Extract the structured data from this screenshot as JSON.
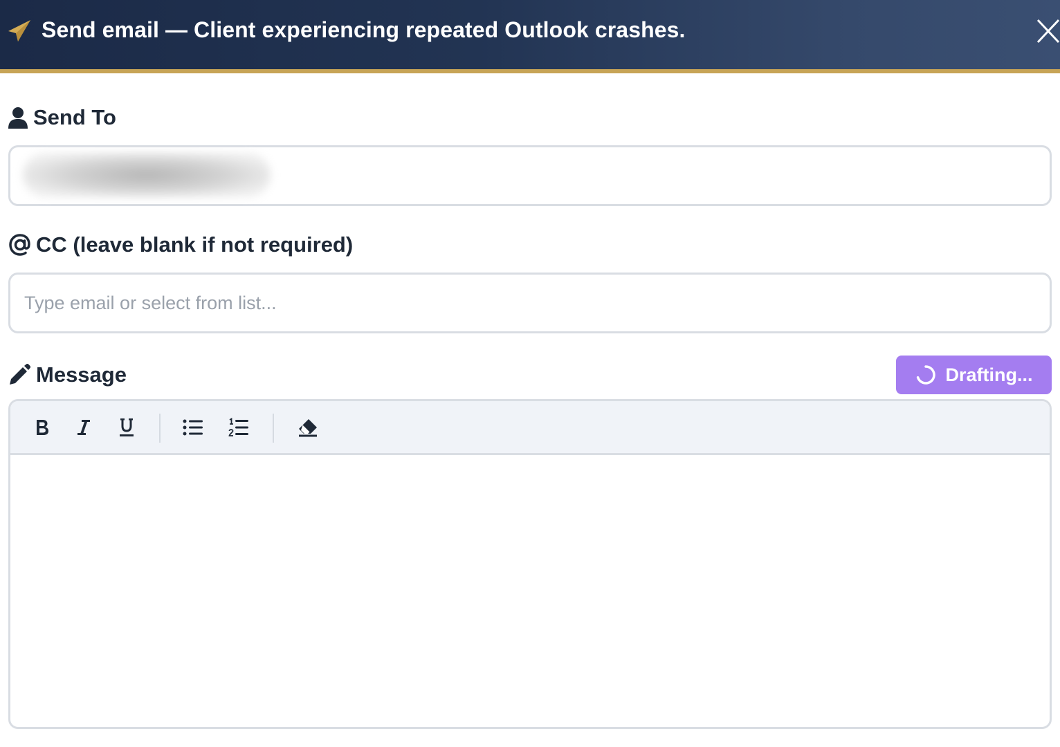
{
  "header": {
    "title": "Send email — Client experiencing repeated Outlook crashes.",
    "icon": "paper-plane-icon",
    "close_icon": "close-icon",
    "accent_color": "#c7a456"
  },
  "send_to": {
    "label": "Send To",
    "icon": "user-icon"
  },
  "cc": {
    "label": "CC (leave blank if not required)",
    "icon": "at-icon",
    "placeholder": "Type email or select from list..."
  },
  "message": {
    "label": "Message",
    "icon": "pencil-icon",
    "draft_button_label": "Drafting...",
    "draft_button_color": "#a47df0",
    "toolbar": [
      "bold-icon",
      "italic-icon",
      "underline-icon",
      "bullet-list-icon",
      "numbered-list-icon",
      "eraser-icon"
    ]
  }
}
